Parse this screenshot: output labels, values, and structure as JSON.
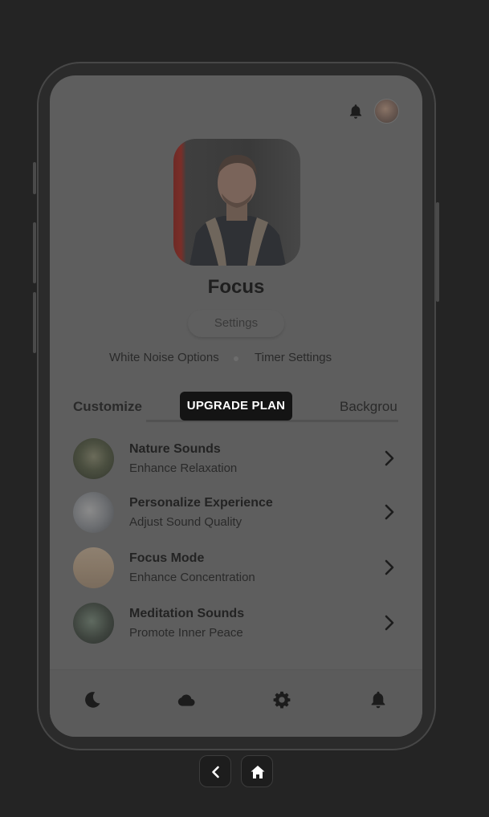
{
  "screen": {
    "title": "Focus",
    "settings_label": "Settings",
    "links": [
      "White Noise Options",
      "Timer Settings"
    ]
  },
  "tabs": {
    "left": "Customize",
    "active": "UPGRADE PLAN",
    "right": "Backgrou"
  },
  "list": [
    {
      "title": "Nature Sounds",
      "subtitle": "Enhance Relaxation",
      "thumb": "forest-thumbnail"
    },
    {
      "title": "Personalize Experience",
      "subtitle": "Adjust Sound Quality",
      "thumb": "studio-thumbnail"
    },
    {
      "title": "Focus Mode",
      "subtitle": "Enhance Concentration",
      "thumb": "desk-thumbnail"
    },
    {
      "title": "Meditation Sounds",
      "subtitle": "Promote Inner Peace",
      "thumb": "meditation-thumbnail"
    }
  ],
  "icons": {
    "top": [
      "bell-icon",
      "avatar"
    ],
    "bottom_nav": [
      "moon-icon",
      "cloud-icon",
      "gear-icon",
      "bell-icon"
    ],
    "system": [
      "back-icon",
      "home-icon"
    ]
  },
  "colors": {
    "background": "#242424",
    "screen": "#5e5e5e",
    "accent_button": "#141414",
    "text": "#232323"
  }
}
